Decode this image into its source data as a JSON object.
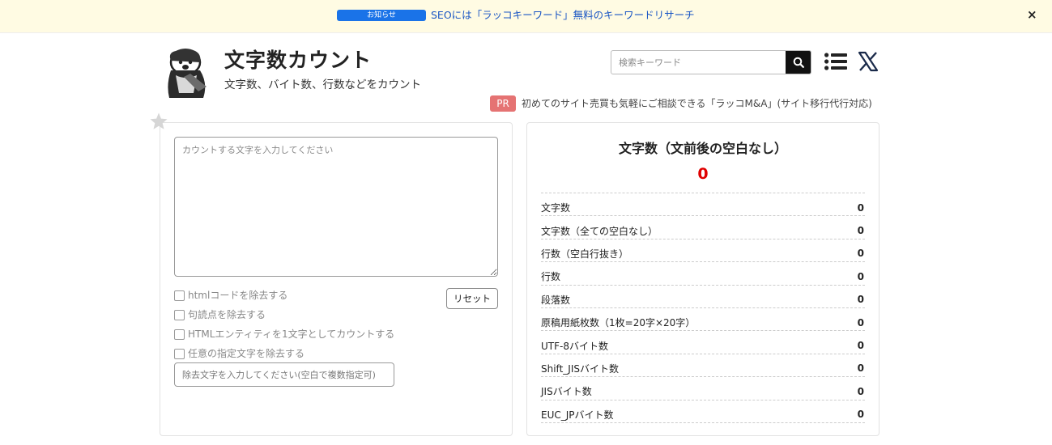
{
  "notice": {
    "badge": "お知らせ",
    "link_text": "SEOには「ラッコキーワード」無料のキーワードリサーチ",
    "close": "×"
  },
  "header": {
    "title": "文字数カウント",
    "subtitle": "文字数、バイト数、行数などをカウント",
    "search_placeholder": "検索キーワード",
    "pr_badge": "PR",
    "pr_text": "初めてのサイト売買も気軽にご相談できる「ラッコM&A」(サイト移行代行対応)"
  },
  "input_panel": {
    "textarea_placeholder": "カウントする文字を入力してください",
    "options": [
      "htmlコードを除去する",
      "句読点を除去する",
      "HTMLエンティティを1文字としてカウントする",
      "任意の指定文字を除去する"
    ],
    "reset_label": "リセット",
    "exclude_placeholder": "除去文字を入力してください(空白で複数指定可)"
  },
  "results": {
    "main_label": "文字数（文前後の空白なし）",
    "main_value": "0",
    "rows": [
      {
        "label": "文字数",
        "value": "0"
      },
      {
        "label": "文字数（全ての空白なし）",
        "value": "0"
      },
      {
        "label": "行数（空白行抜き）",
        "value": "0"
      },
      {
        "label": "行数",
        "value": "0"
      },
      {
        "label": "段落数",
        "value": "0"
      },
      {
        "label": "原稿用紙枚数（1枚=20字×20字）",
        "value": "0"
      },
      {
        "label": "UTF-8バイト数",
        "value": "0"
      },
      {
        "label": "Shift_JISバイト数",
        "value": "0"
      },
      {
        "label": "JISバイト数",
        "value": "0"
      },
      {
        "label": "EUC_JPバイト数",
        "value": "0"
      }
    ]
  },
  "icons": [
    "star-icon",
    "search-icon",
    "menu-icon",
    "x-logo-icon",
    "mascot-logo",
    "close-icon"
  ],
  "colors": {
    "notice_bg": "#fffbe3",
    "notice_badge": "#1a73e8",
    "link": "#1a56c4",
    "pr_badge": "#e57373",
    "main_value": "#e00000"
  }
}
